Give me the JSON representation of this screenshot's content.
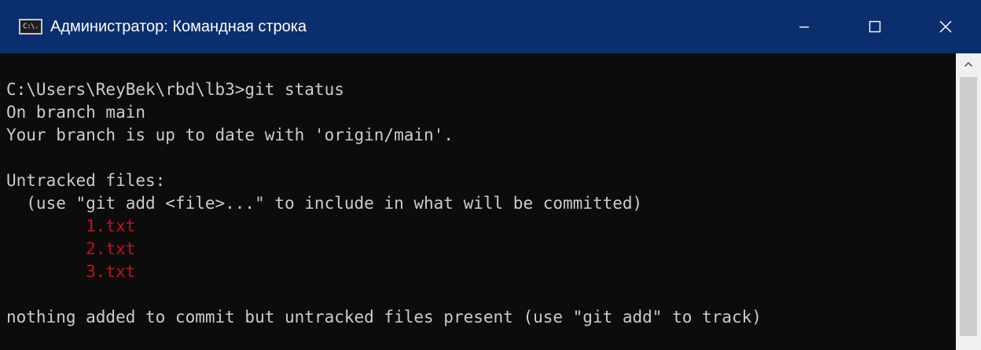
{
  "window": {
    "title": "Администратор: Командная строка",
    "icon": "cmd-icon",
    "icon_text": "C:\\.",
    "controls": {
      "minimize_icon": "minimize-icon",
      "maximize_icon": "maximize-icon",
      "close_icon": "close-icon"
    },
    "colors": {
      "titlebar": "#0b2e6e",
      "console_bg": "#0c0c0c",
      "console_text": "#cccccc",
      "untracked_text": "#c50f1f"
    }
  },
  "console": {
    "prompt_command": "C:\\Users\\ReyBek\\rbd\\lb3>git status",
    "branch_line": "On branch main",
    "uptodate_line": "Your branch is up to date with 'origin/main'.",
    "untracked_header": "Untracked files:",
    "untracked_hint": "  (use \"git add <file>...\" to include in what will be committed)",
    "untracked_files": [
      "        1.txt",
      "        2.txt",
      "        3.txt"
    ],
    "summary_line": "nothing added to commit but untracked files present (use \"git add\" to track)"
  },
  "scrollbar": {
    "up_icon": "chevron-up-icon"
  }
}
